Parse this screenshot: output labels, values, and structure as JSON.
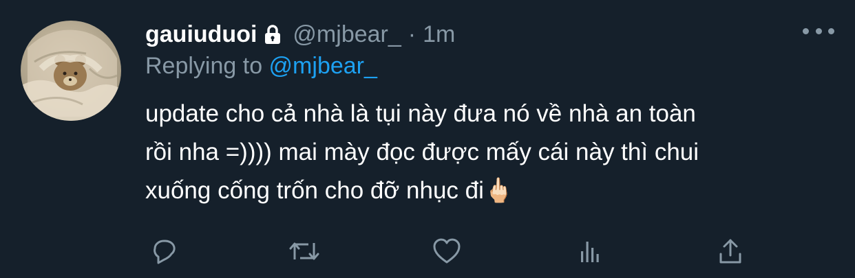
{
  "tweet": {
    "display_name": "gauiuduoi",
    "handle": "@mjbear_",
    "separator": "·",
    "time": "1m",
    "replying_prefix": "Replying to ",
    "replying_to": "@mjbear_",
    "text_lines": [
      "update cho cả nhà là tụi này đưa nó về nhà an toàn",
      "rồi nha =)))) mai mày đọc được mấy cái này thì chui",
      "xuống cống trốn cho đỡ nhục đi🖕🏻"
    ],
    "icons": {
      "account": "lock-icon",
      "more": "more-dots-icon",
      "actions": [
        "reply-icon",
        "retweet-icon",
        "like-icon",
        "analytics-icon",
        "share-icon"
      ]
    },
    "colors": {
      "background": "#15202b",
      "text": "#ffffff",
      "secondary": "#8899a6",
      "accent": "#1da1f2"
    }
  }
}
